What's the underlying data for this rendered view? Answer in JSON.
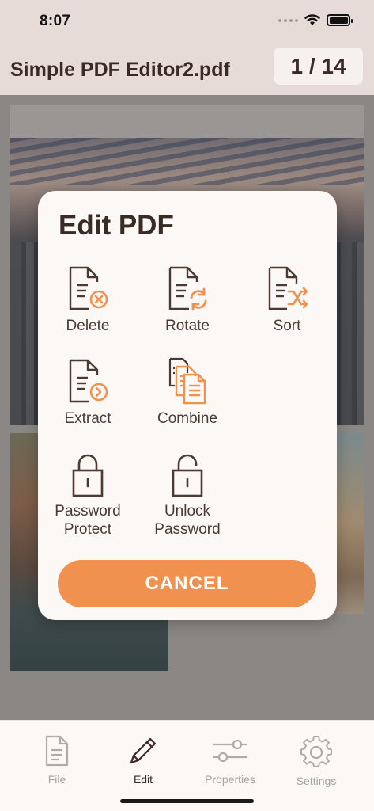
{
  "status": {
    "time": "8:07"
  },
  "header": {
    "title": "Simple PDF Editor2.pdf",
    "page_counter": "1 / 14"
  },
  "modal": {
    "title": "Edit PDF",
    "options": {
      "delete": "Delete",
      "rotate": "Rotate",
      "sort": "Sort",
      "extract": "Extract",
      "combine": "Combine",
      "password_protect_line1": "Password",
      "password_protect_line2": "Protect",
      "unlock_password_line1": "Unlock",
      "unlock_password_line2": "Password"
    },
    "cancel_label": "CANCEL"
  },
  "tabbar": {
    "tabs": [
      {
        "label": "File",
        "icon": "file-icon",
        "active": false
      },
      {
        "label": "Edit",
        "icon": "pencil-icon",
        "active": true
      },
      {
        "label": "Properties",
        "icon": "sliders-icon",
        "active": false
      },
      {
        "label": "Settings",
        "icon": "gear-icon",
        "active": false
      }
    ]
  },
  "colors": {
    "accent": "#f1914f",
    "text_dark": "#3a2a24",
    "inactive": "#a8a09b"
  }
}
